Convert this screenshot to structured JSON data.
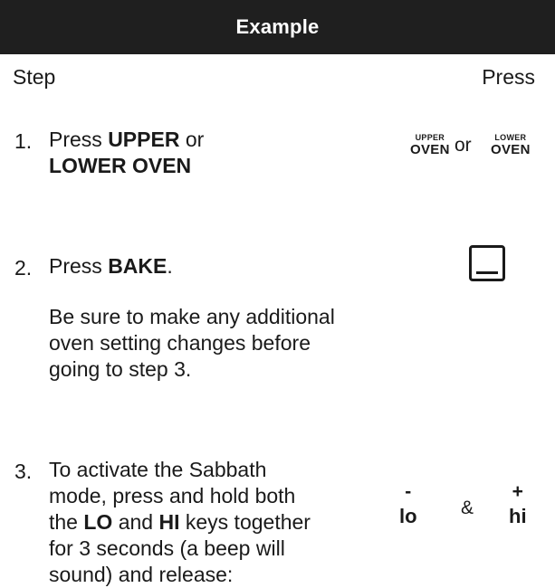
{
  "header": {
    "title": "Example"
  },
  "columns": {
    "step": "Step",
    "press": "Press"
  },
  "steps": [
    {
      "number": "1.",
      "lines": [
        {
          "pre": "Press ",
          "bold": "UPPER",
          "post": " or"
        },
        {
          "pre": "",
          "bold": "LOWER OVEN",
          "post": ""
        }
      ],
      "keys": {
        "upper_small": "UPPER",
        "upper_big": "OVEN",
        "or": "or",
        "lower_small": "LOWER",
        "lower_big": "OVEN"
      }
    },
    {
      "number": "2.",
      "lines": [
        {
          "pre": "Press ",
          "bold": "BAKE",
          "post": "."
        }
      ],
      "note_lines": [
        "Be sure to make any additional",
        "oven setting changes before",
        "going to step 3."
      ],
      "keys": {
        "bake_icon": "bake-key-icon"
      }
    },
    {
      "number": "3.",
      "lines": [
        {
          "pre": "To activate the Sabbath",
          "bold": "",
          "post": ""
        },
        {
          "pre": "mode, press and hold both",
          "bold": "",
          "post": ""
        },
        {
          "pre": "the ",
          "bold": "LO",
          "post": " and "
        },
        {
          "pre": "",
          "bold": "",
          "post": ""
        },
        {
          "pre": "for 3 seconds (a beep will",
          "bold": "",
          "post": ""
        },
        {
          "pre": "sound) and release:",
          "bold": "",
          "post": ""
        }
      ],
      "line3_bold2": "HI",
      "line3_tail": " keys together",
      "line4_text": "for 3 seconds (a beep will",
      "keys": {
        "lo_sign": "-",
        "lo_label": "lo",
        "amp": "&",
        "hi_sign": "+",
        "hi_label": "hi"
      }
    }
  ]
}
